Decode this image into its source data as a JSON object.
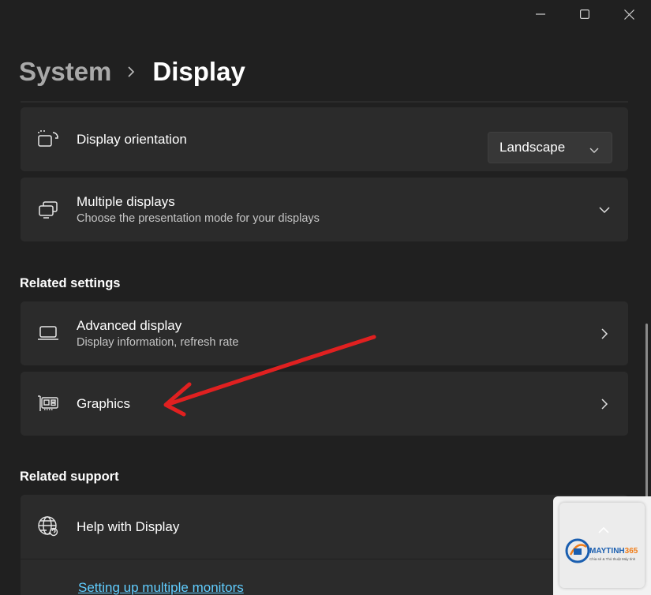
{
  "window": {
    "minimize_icon": "minimize-icon",
    "maximize_icon": "maximize-icon",
    "close_icon": "close-icon"
  },
  "breadcrumb": {
    "parent": "System",
    "current": "Display"
  },
  "cards": {
    "orientation": {
      "icon": "display-orientation-icon",
      "title": "Display orientation",
      "dropdown_value": "Landscape"
    },
    "multiple_displays": {
      "icon": "multiple-displays-icon",
      "title": "Multiple displays",
      "subtitle": "Choose the presentation mode for your displays"
    },
    "advanced_display": {
      "icon": "laptop-icon",
      "title": "Advanced display",
      "subtitle": "Display information, refresh rate"
    },
    "graphics": {
      "icon": "graphics-card-icon",
      "title": "Graphics"
    },
    "help_display": {
      "icon": "globe-icon",
      "title": "Help with Display"
    }
  },
  "sections": {
    "related_settings": "Related settings",
    "related_support": "Related support"
  },
  "links": {
    "multiple_monitors": "Setting up multiple monitors"
  },
  "watermark": {
    "brand_main": "MAYTINH",
    "brand_accent": "365",
    "tagline": "Chia sẻ & Thủ thuật Máy tính"
  },
  "colors": {
    "background": "#202020",
    "card": "#2b2b2b",
    "link": "#60cdff",
    "annotation_arrow": "#e02020"
  }
}
